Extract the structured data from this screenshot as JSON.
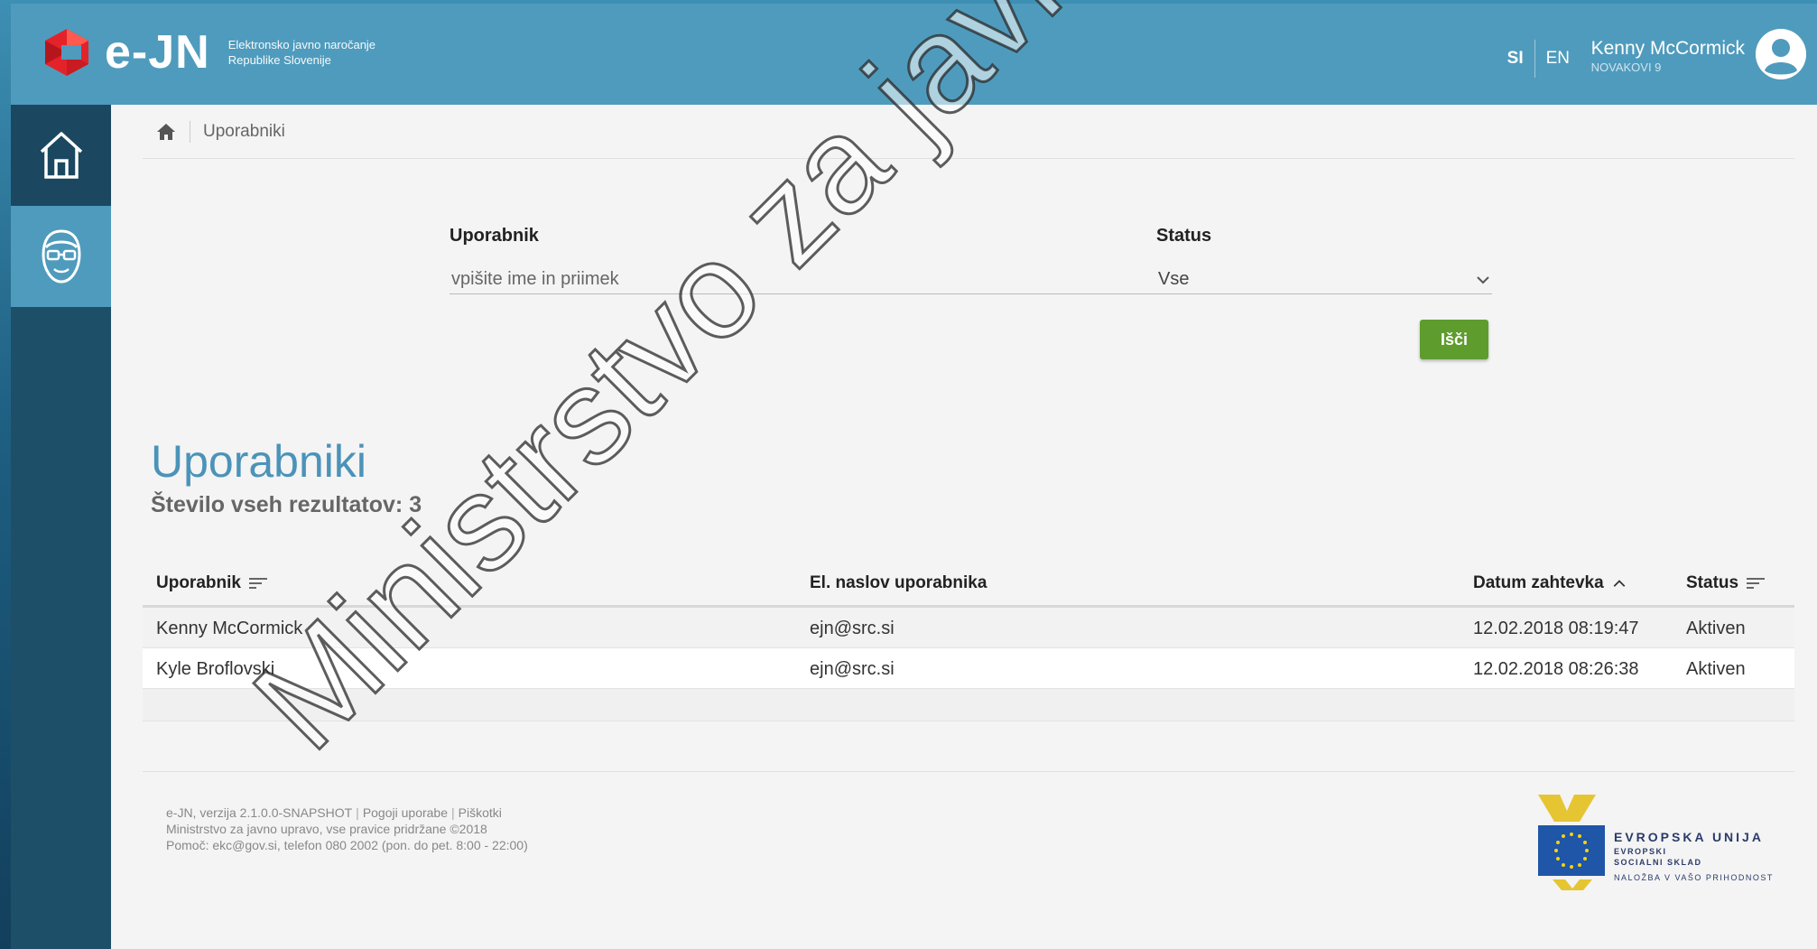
{
  "header": {
    "logo_text": "e-JN",
    "logo_sub_line1": "Elektronsko javno naročanje",
    "logo_sub_line2": "Republike Slovenije",
    "lang_si": "SI",
    "lang_en": "EN",
    "user_name": "Kenny McCormick",
    "user_org": "NOVAKOVI 9"
  },
  "breadcrumb": {
    "current": "Uporabniki"
  },
  "filter": {
    "user_label": "Uporabnik",
    "user_placeholder": "vpišite ime in priimek",
    "status_label": "Status",
    "status_value": "Vse",
    "search_button": "Išči"
  },
  "results": {
    "title": "Uporabniki",
    "count_text": "Število vseh rezultatov: 3"
  },
  "table": {
    "columns": [
      "Uporabnik",
      "El. naslov uporabnika",
      "Datum zahtevka",
      "Status"
    ],
    "rows": [
      [
        "Kenny McCormick",
        "ejn@src.si",
        "12.02.2018 08:19:47",
        "Aktiven"
      ],
      [
        "Kyle Broflovski",
        "ejn@src.si",
        "12.02.2018 08:26:38",
        "Aktiven"
      ]
    ]
  },
  "footer": {
    "version": "e-JN, verzija 2.1.0.0-SNAPSHOT",
    "terms": "Pogoji uporabe",
    "cookies": "Piškotki",
    "rights": "Ministrstvo za javno upravo, vse pravice pridržane ©2018",
    "help": "Pomoč: ekc@gov.si, telefon 080 2002 (pon. do pet. 8:00 - 22:00)"
  },
  "eu_logo": {
    "line1": "EVROPSKA UNIJA",
    "line2": "EVROPSKI",
    "line3": "SOCIALNI SKLAD",
    "line4": "NALOŽBA V VAŠO PRIHODNOST"
  },
  "watermark": "Ministrstvo za javno upravo",
  "colors": {
    "header": "#4f9bbd",
    "sidebar": "#1e4f68",
    "accent_title": "#4b93b8",
    "search_button": "#5e9c2e"
  }
}
